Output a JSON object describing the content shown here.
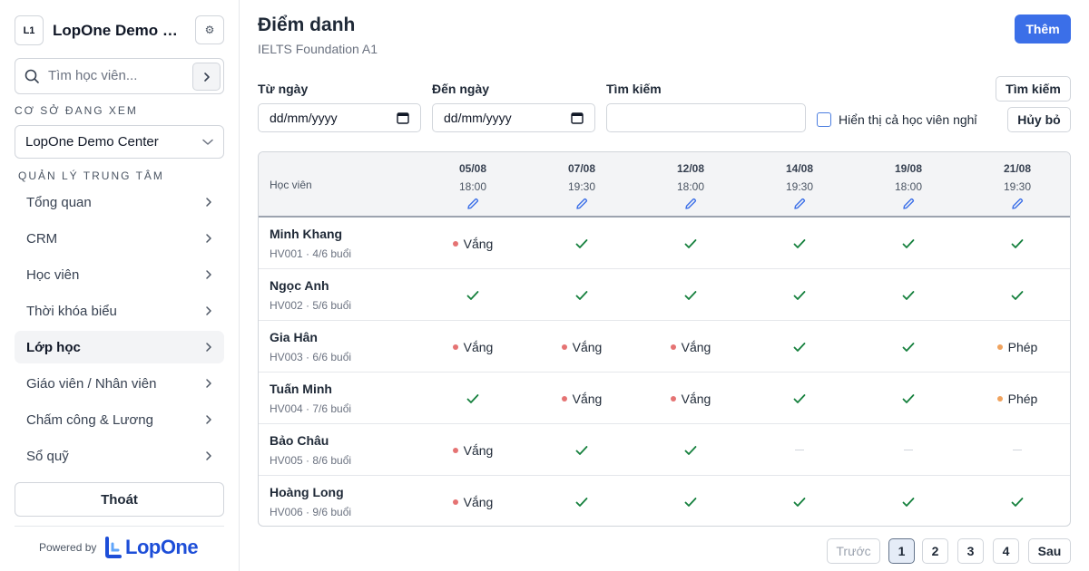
{
  "sidebar": {
    "logo_initials": "L1",
    "app_title": "LopOne Demo Center",
    "search_placeholder": "Tìm học viên...",
    "viewing_label": "CƠ SỞ ĐANG XEM",
    "center_select_value": "LopOne Demo Center",
    "manage_label": "QUẢN LÝ TRUNG TÂM",
    "nav_items": [
      {
        "label": "Tổng quan",
        "active": false
      },
      {
        "label": "CRM",
        "active": false
      },
      {
        "label": "Học viên",
        "active": false
      },
      {
        "label": "Thời khóa biểu",
        "active": false
      },
      {
        "label": "Lớp học",
        "active": true
      },
      {
        "label": "Giáo viên / Nhân viên",
        "active": false
      },
      {
        "label": "Chấm công & Lương",
        "active": false
      },
      {
        "label": "Sổ quỹ",
        "active": false
      }
    ],
    "logout_label": "Thoát",
    "powered_by": "Powered by",
    "brand_name": "LopOne"
  },
  "header": {
    "title": "Điểm danh",
    "subtitle": "IELTS Foundation A1",
    "add_label": "Thêm"
  },
  "filters": {
    "from_label": "Từ ngày",
    "from_value": "dd/mm/yyyy",
    "to_label": "Đến ngày",
    "to_value": "dd/mm/yyyy",
    "search_label": "Tìm kiếm",
    "search_value": "",
    "show_inactive_label": "Hiển thị cả học viên nghỉ",
    "show_inactive_checked": false,
    "search_button": "Tìm kiếm",
    "cancel_button": "Hủy bỏ"
  },
  "table": {
    "student_header": "Học viên",
    "sessions": [
      {
        "date": "05/08",
        "time": "18:00"
      },
      {
        "date": "07/08",
        "time": "19:30"
      },
      {
        "date": "12/08",
        "time": "18:00"
      },
      {
        "date": "14/08",
        "time": "19:30"
      },
      {
        "date": "19/08",
        "time": "18:00"
      },
      {
        "date": "21/08",
        "time": "19:30"
      }
    ],
    "status_labels": {
      "absent": "Vắng",
      "excused": "Phép"
    },
    "rows": [
      {
        "name": "Minh Khang",
        "meta": "HV001 · 4/6 buổi",
        "statuses": [
          "absent",
          "present",
          "present",
          "present",
          "present",
          "present"
        ]
      },
      {
        "name": "Ngọc Anh",
        "meta": "HV002 · 5/6 buổi",
        "statuses": [
          "present",
          "present",
          "present",
          "present",
          "present",
          "present"
        ]
      },
      {
        "name": "Gia Hân",
        "meta": "HV003 · 6/6 buổi",
        "statuses": [
          "absent",
          "absent",
          "absent",
          "present",
          "present",
          "excused"
        ]
      },
      {
        "name": "Tuấn Minh",
        "meta": "HV004 · 7/6 buổi",
        "statuses": [
          "present",
          "absent",
          "absent",
          "present",
          "present",
          "excused"
        ]
      },
      {
        "name": "Bảo Châu",
        "meta": "HV005 · 8/6 buổi",
        "statuses": [
          "absent",
          "present",
          "present",
          "none",
          "none",
          "none"
        ]
      },
      {
        "name": "Hoàng Long",
        "meta": "HV006 · 9/6 buổi",
        "statuses": [
          "absent",
          "present",
          "present",
          "present",
          "present",
          "present"
        ]
      }
    ]
  },
  "pagination": {
    "prev_label": "Trước",
    "pages": [
      "1",
      "2",
      "3",
      "4"
    ],
    "current_page": "1",
    "next_label": "Sau"
  },
  "colors": {
    "primary": "#3b6fe8",
    "present_check": "#15803d",
    "absent_dot": "#e57373",
    "excused_dot": "#f0a35e",
    "pencil": "#3b6fe8"
  },
  "icons": {
    "search": "search-icon",
    "settings": "gear-icon",
    "chevron_right": "chevron-right-icon",
    "chevron_down": "chevron-down-icon",
    "calendar": "calendar-icon",
    "edit": "pencil-icon",
    "present": "check-icon"
  }
}
